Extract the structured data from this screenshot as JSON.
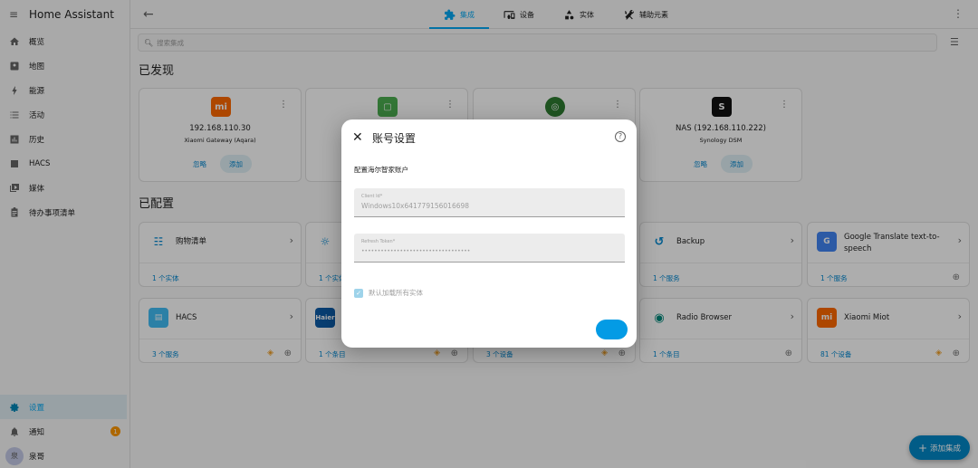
{
  "app": {
    "title": "Home Assistant"
  },
  "sidebar": {
    "items": [
      {
        "label": "概览",
        "icon": "home-icon"
      },
      {
        "label": "地图",
        "icon": "map-icon"
      },
      {
        "label": "能源",
        "icon": "lightning-icon"
      },
      {
        "label": "活动",
        "icon": "list-icon"
      },
      {
        "label": "历史",
        "icon": "chart-icon"
      },
      {
        "label": "HACS",
        "icon": "hacs-icon"
      },
      {
        "label": "媒体",
        "icon": "media-icon"
      },
      {
        "label": "待办事项清单",
        "icon": "clipboard-icon"
      }
    ],
    "settings_label": "设置",
    "notifications_label": "通知",
    "notifications_count": "1",
    "user_initial": "泉",
    "user_name": "泉哥"
  },
  "topbar": {
    "tabs": [
      {
        "label": "集成",
        "active": true
      },
      {
        "label": "设备",
        "active": false
      },
      {
        "label": "实体",
        "active": false
      },
      {
        "label": "辅助元素",
        "active": false
      }
    ]
  },
  "search": {
    "placeholder": "搜索集成"
  },
  "discovered": {
    "heading": "已发现",
    "ignore_label": "忽略",
    "add_label": "添加",
    "cards": [
      {
        "name": "192.168.110.30",
        "sub": "Xiaomi Gateway (Aqara)",
        "logo_color": "#ff6900"
      },
      {
        "name": "",
        "sub": "",
        "logo_color": "#4caf50"
      },
      {
        "name": "",
        "sub": "",
        "logo_color": "#2e7d32"
      },
      {
        "name": "NAS (192.168.110.222)",
        "sub": "Synology DSM",
        "logo_color": "#111111"
      }
    ]
  },
  "configured": {
    "heading": "已配置",
    "row1": [
      {
        "title": "购物清单",
        "link": "1 个实体"
      },
      {
        "title": "",
        "link": "1 个实体"
      },
      {
        "title": "",
        "link": ""
      },
      {
        "title": "Backup",
        "link": "1 个服务"
      },
      {
        "title": "Google Translate text-to-speech",
        "link": "1 个服务"
      }
    ],
    "row2": [
      {
        "title": "HACS",
        "link": "3 个服务"
      },
      {
        "title": "",
        "link": "1 个条目"
      },
      {
        "title": "",
        "link": "3 个设备"
      },
      {
        "title": "Radio Browser",
        "link": "1 个条目"
      },
      {
        "title": "Xiaomi Miot",
        "link": "81 个设备"
      }
    ]
  },
  "dialog": {
    "title": "账号设置",
    "description": "配置海尔智家账户",
    "client_id_label": "Client Id*",
    "client_id_value": "Windows10x641779156016698",
    "token_label": "Refresh Token*",
    "token_value": "••••••••••••••••••••••••••••••••••",
    "checkbox_label": "默认加载所有实体"
  },
  "fab": {
    "label": "添加集成"
  },
  "colors": {
    "accent": "#03a9f4",
    "brand_xiaomi": "#ff6900",
    "haier": "#0d5ca8"
  }
}
